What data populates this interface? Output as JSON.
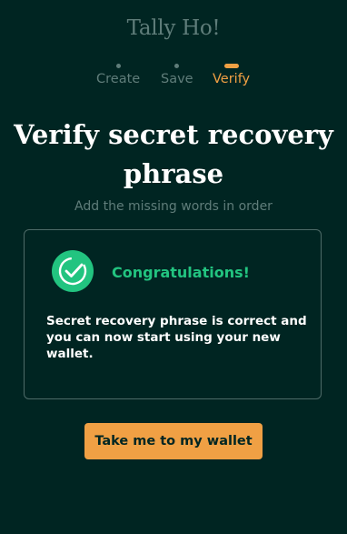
{
  "brand": {
    "logo_text": "Tally Ho!"
  },
  "steps": [
    {
      "label": "Create",
      "active": false
    },
    {
      "label": "Save",
      "active": false
    },
    {
      "label": "Verify",
      "active": true
    }
  ],
  "header": {
    "title": "Verify secret recovery phrase",
    "subtitle": "Add the missing words in order"
  },
  "result_card": {
    "icon": "check-circle-icon",
    "heading": "Congratulations!",
    "message": "Secret recovery phrase is correct and you can now start using your new wallet."
  },
  "actions": {
    "primary_label": "Take me to my wallet"
  },
  "colors": {
    "background": "#002522",
    "accent": "#f0a044",
    "success": "#22c480",
    "muted": "#5f7d7a",
    "text": "#ffffff"
  }
}
